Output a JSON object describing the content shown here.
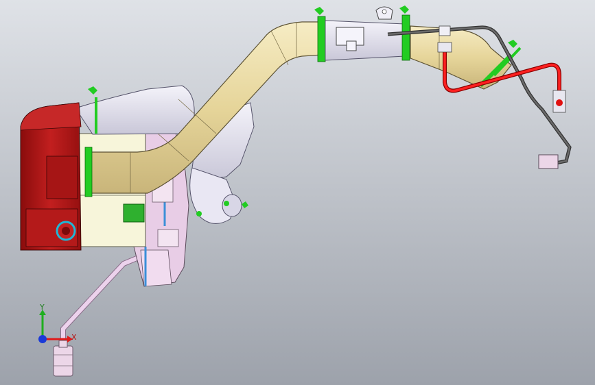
{
  "scene": {
    "background_top": "#dfe2e7",
    "background_bottom": "#9da2ab",
    "colors": {
      "duct": "#eadba2",
      "duct_shade": "#c5b478",
      "plenum_red": "#b01818",
      "plenum_red_dark": "#7a0a0a",
      "housing_cream": "#f7f5d9",
      "metal_lavender": "#e6e4f0",
      "motor_pink": "#e8c9e6",
      "clamp_green": "#22cc22",
      "hose_red": "#e01010",
      "hose_dark": "#555555",
      "hose_pink": "#e6c8e6",
      "fan_blue": "#3b8fd8"
    }
  },
  "triad": {
    "x_label": "X",
    "y_label": "Y",
    "x_color": "#e01a1a",
    "y_color": "#1fae1f",
    "z_color": "#1a3ad8"
  }
}
